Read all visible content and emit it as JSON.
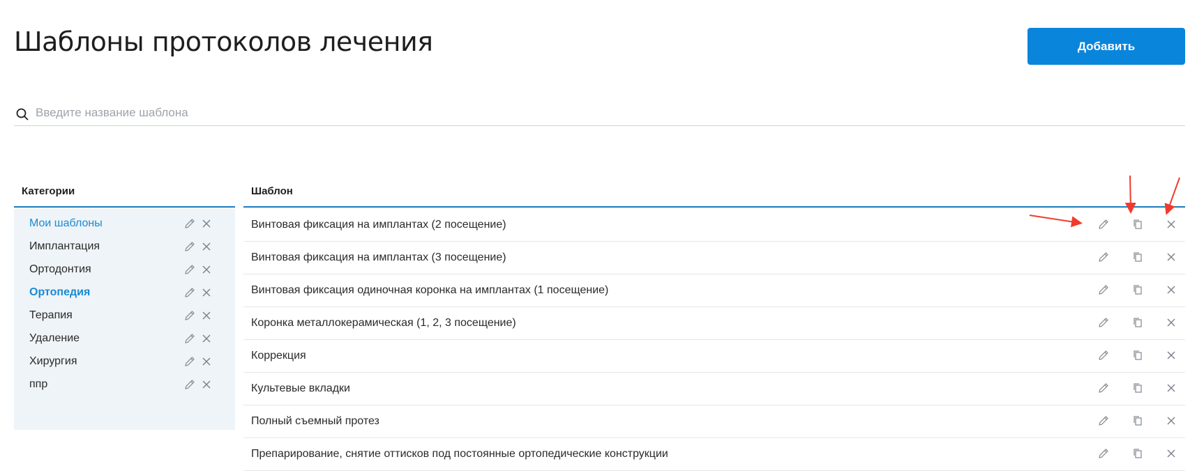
{
  "page": {
    "title": "Шаблоны протоколов лечения",
    "add_button_label": "Добавить"
  },
  "search": {
    "placeholder": "Введите название шаблона",
    "value": ""
  },
  "categories": {
    "header": "Категории",
    "active_color": "#1a8ad4",
    "items": [
      {
        "label": "Мои шаблоны",
        "state": "highlighted"
      },
      {
        "label": "Имплантация",
        "state": "normal"
      },
      {
        "label": "Ортодонтия",
        "state": "normal"
      },
      {
        "label": "Ортопедия",
        "state": "selected"
      },
      {
        "label": "Терапия",
        "state": "normal"
      },
      {
        "label": "Удаление",
        "state": "normal"
      },
      {
        "label": "Хирургия",
        "state": "normal"
      },
      {
        "label": "ппр",
        "state": "normal"
      }
    ],
    "item_icons": [
      "pencil-icon",
      "close-icon"
    ]
  },
  "templates": {
    "header": "Шаблон",
    "row_icons": [
      "pencil-icon",
      "copy-icon",
      "close-icon"
    ],
    "rows": [
      {
        "name": "Винтовая фиксация на имплантах (2 посещение)"
      },
      {
        "name": "Винтовая фиксация на имплантах (3 посещение)"
      },
      {
        "name": "Винтовая фиксация одиночная коронка на имплантах (1 посещение)"
      },
      {
        "name": "Коронка металлокерамическая (1, 2, 3 посещение)"
      },
      {
        "name": "Коррекция"
      },
      {
        "name": "Культевые вкладки"
      },
      {
        "name": "Полный съемный протез"
      },
      {
        "name": "Препарирование, снятие оттисков под постоянные ортопедические конструкции"
      }
    ]
  },
  "annotations": {
    "arrow_color": "#ef3b2d",
    "targets": [
      "edit",
      "copy",
      "delete"
    ]
  },
  "colors": {
    "accent": "#0a85dc",
    "header_rule": "#1a7cc2",
    "panel_bg": "#eef4f7"
  }
}
